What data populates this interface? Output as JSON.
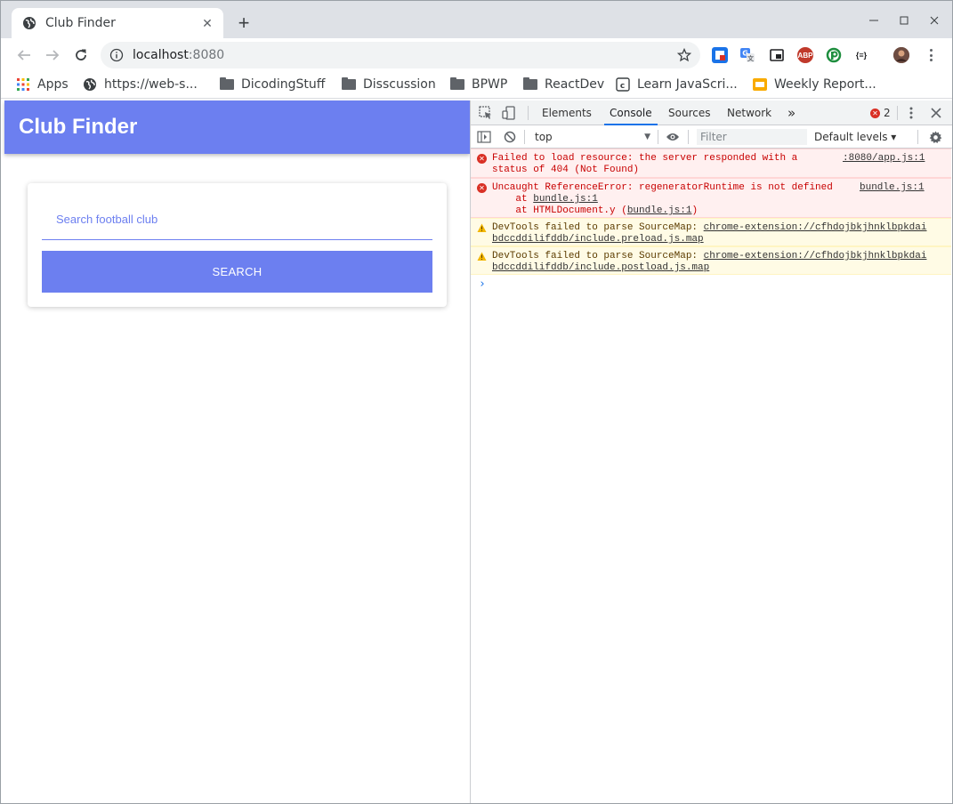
{
  "browser": {
    "tab_title": "Club Finder",
    "url_host": "localhost",
    "url_port": ":8080"
  },
  "bookmarks": [
    {
      "label": "Apps"
    },
    {
      "label": "https://web-s..."
    },
    {
      "label": "DicodingStuff"
    },
    {
      "label": "Disscussion"
    },
    {
      "label": "BPWP"
    },
    {
      "label": "ReactDev"
    },
    {
      "label": "Learn JavaScri..."
    },
    {
      "label": "Weekly Report..."
    }
  ],
  "app": {
    "title": "Club Finder",
    "search_placeholder": "Search football club",
    "search_button": "SEARCH",
    "accent_color": "#6c7ff0"
  },
  "devtools": {
    "tabs": [
      "Elements",
      "Console",
      "Sources",
      "Network"
    ],
    "more_tabs": "»",
    "active_tab": "Console",
    "error_count": "2",
    "context": "top",
    "filter_placeholder": "Filter",
    "levels": "Default levels ▾",
    "messages": [
      {
        "level": "error",
        "line1": "Failed to load resource: the server responded with a",
        "line2": "status of 404 (Not Found)",
        "source": ":8080/app.js:1"
      },
      {
        "level": "error",
        "line1": "Uncaught ReferenceError: regeneratorRuntime is not defined",
        "line2_prefix": "    at ",
        "line2_link": "bundle.js:1",
        "line3_prefix": "    at HTMLDocument.y (",
        "line3_link": "bundle.js:1",
        "line3_suffix": ")",
        "source": "bundle.js:1"
      },
      {
        "level": "warning",
        "prefix": "DevTools failed to parse SourceMap: ",
        "link1": "chrome-extension://cfhdojbkjhnklbpkdai",
        "link2": "bdccddilifddb/include.preload.js.map"
      },
      {
        "level": "warning",
        "prefix": "DevTools failed to parse SourceMap: ",
        "link1": "chrome-extension://cfhdojbkjhnklbpkdai",
        "link2": "bdccddilifddb/include.postload.js.map"
      }
    ],
    "prompt": "›"
  }
}
